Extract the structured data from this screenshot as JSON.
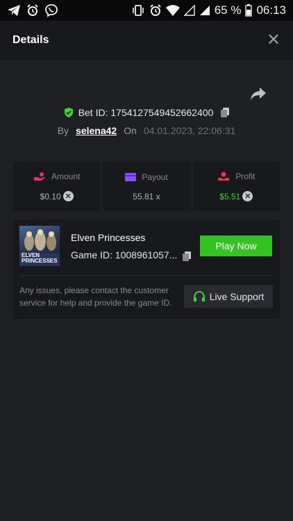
{
  "status_bar": {
    "battery": "65 %",
    "time": "06:13",
    "icons": [
      "telegram-icon",
      "alarm-icon",
      "viber-icon",
      "vibrate-icon",
      "alarm-icon",
      "wifi-icon",
      "signal-icon",
      "signal-icon",
      "battery-icon"
    ]
  },
  "header": {
    "title": "Details",
    "close_icon": "close-icon"
  },
  "bet": {
    "id_label": "Bet ID: 1754127549452662400",
    "by_label": "By",
    "username": "selena42",
    "on_label": "On",
    "date": "04.01.2023, 22:06:31"
  },
  "stats": {
    "amount": {
      "label": "Amount",
      "value": "$0.10",
      "icon_color": "#e8306a"
    },
    "payout": {
      "label": "Payout",
      "value": "55.81 x",
      "icon_color": "#8a4dff"
    },
    "profit": {
      "label": "Profit",
      "value": "$5.51",
      "icon_color": "#e8364a",
      "value_color": "#3fd33b"
    }
  },
  "game": {
    "title": "Elven Princesses",
    "game_id": "Game ID: 1008961057...",
    "thumb_text_line1": "ELVEN",
    "thumb_text_line2": "PRINCESSES",
    "play_label": "Play Now"
  },
  "support": {
    "text": "Any issues, please contact the customer service for help and provide the game ID.",
    "button_label": "Live Support"
  },
  "colors": {
    "accent_green": "#34c322",
    "background": "#1f2024",
    "card": "#18191c"
  }
}
